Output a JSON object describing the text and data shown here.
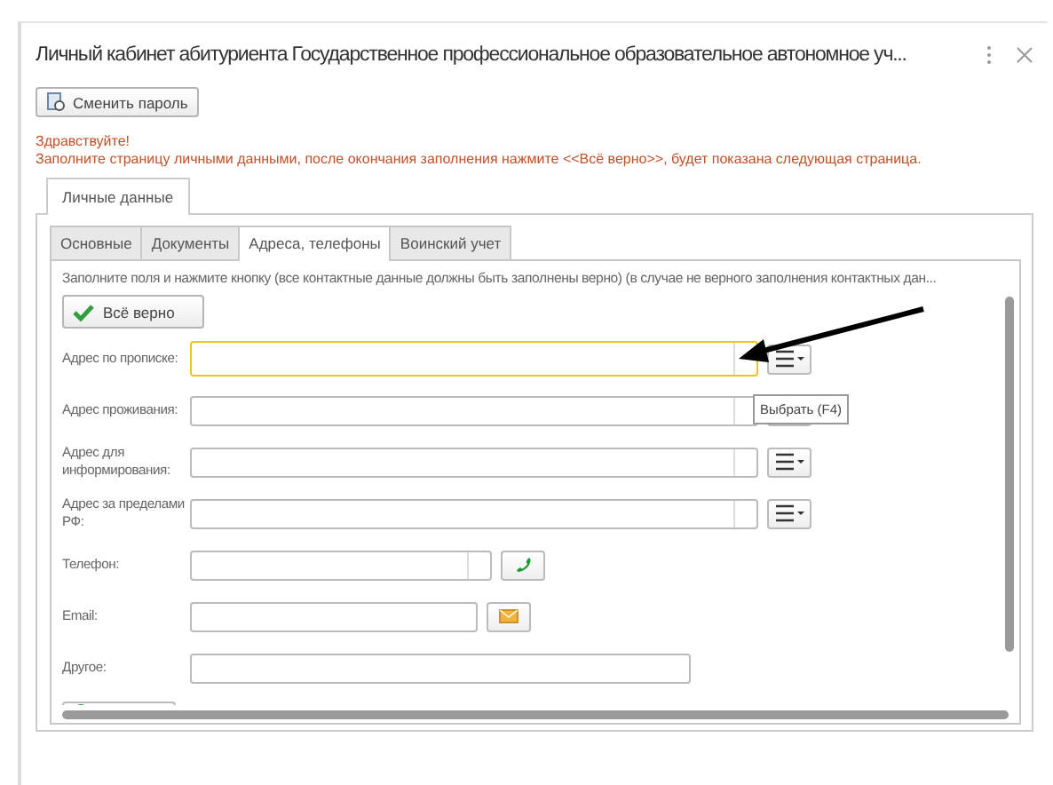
{
  "window": {
    "title": "Личный кабинет абитуриента Государственное профессиональное образовательное автономное уч..."
  },
  "toolbar": {
    "button": "Сменить пароль"
  },
  "messages": [
    "Здравствуйте!",
    "Заполните страницу личными данными, после окончания заполнения нажмите <<Всё верно>>, будет показана следующая страница."
  ],
  "outer_tabs": [
    {
      "label": "Личные данные",
      "selected": true
    }
  ],
  "tabs": [
    {
      "label": "Основные",
      "selected": false
    },
    {
      "label": "Документы",
      "selected": false
    },
    {
      "label": "Адреса, телефоны",
      "selected": true
    },
    {
      "label": "Воинский учет",
      "selected": false
    }
  ],
  "hint": "Заполните поля и нажмите кнопку (все контактные данные должны быть заполнены верно) (в случае не верного заполнения контактных дан...",
  "confirm_button": "Всё верно",
  "fields": [
    {
      "label": "Адрес по прописке:",
      "kind": "address",
      "focused": true
    },
    {
      "label": "Адрес проживания:",
      "kind": "address",
      "focused": false
    },
    {
      "label": "Адрес для информирования:",
      "kind": "address",
      "focused": false
    },
    {
      "label": "Адрес за пределами РФ:",
      "kind": "address",
      "focused": false
    },
    {
      "label": "Телефон:",
      "kind": "phone",
      "focused": false
    },
    {
      "label": "Email:",
      "kind": "email",
      "focused": false
    },
    {
      "label": "Другое:",
      "kind": "text",
      "focused": false
    }
  ],
  "tooltip": "Выбрать (F4)"
}
